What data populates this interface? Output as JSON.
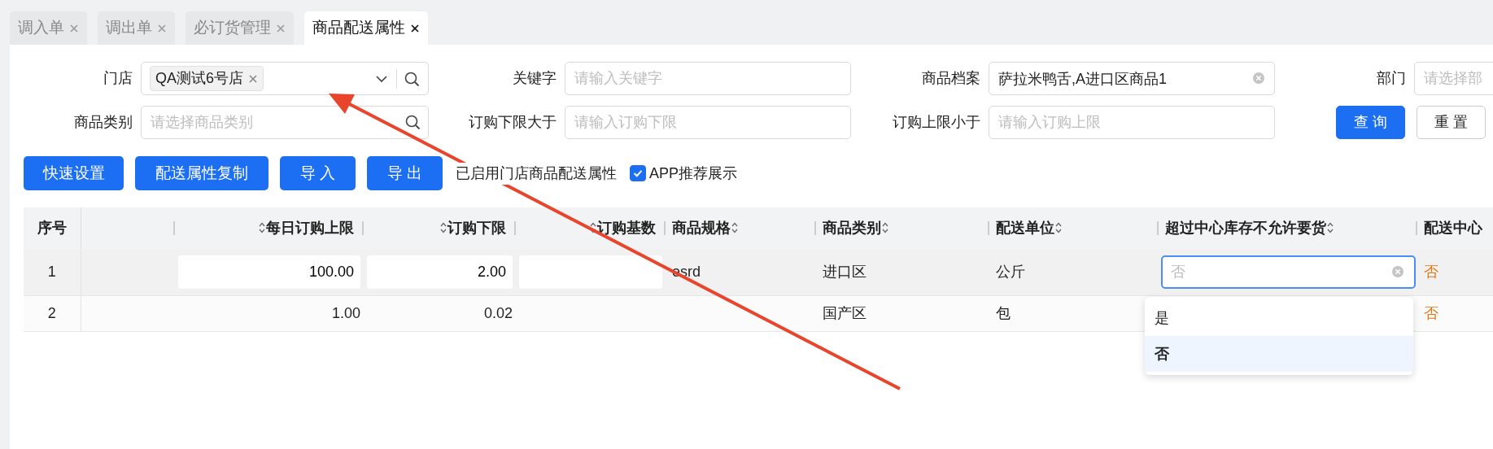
{
  "tabs": [
    {
      "label": "调入单",
      "selected": false
    },
    {
      "label": "调出单",
      "selected": false
    },
    {
      "label": "必订货管理",
      "selected": false
    },
    {
      "label": "商品配送属性",
      "selected": true
    }
  ],
  "filters": [
    {
      "label": "门店",
      "kind": "tags",
      "tags": [
        "QA测试6号店"
      ]
    },
    {
      "label": "关键字",
      "kind": "input",
      "placeholder": "请输入关键字"
    },
    {
      "label": "商品档案",
      "kind": "clearable",
      "value": "萨拉米鸭舌,A进口区商品1"
    },
    {
      "label": "部门",
      "kind": "input",
      "placeholder": "请选择部"
    },
    {
      "label": "商品类别",
      "kind": "search",
      "placeholder": "请选择商品类别"
    },
    {
      "label": "订购下限大于",
      "kind": "input",
      "placeholder": "请输入订购下限"
    },
    {
      "label": "订购上限小于",
      "kind": "input",
      "placeholder": "请输入订购上限"
    }
  ],
  "form_buttons": [
    {
      "label": "查 询",
      "kind": "primary"
    },
    {
      "label": "重 置",
      "kind": "default"
    }
  ],
  "actions": [
    "快速设置",
    "配送属性复制",
    "导 入",
    "导 出"
  ],
  "status_text": "已启用门店商品配送属性",
  "app_checkbox": {
    "label": "APP推荐展示",
    "checked": true
  },
  "table": {
    "columns": [
      {
        "label": "序号",
        "kind": "index"
      },
      {
        "kind": "blank"
      },
      {
        "label": "每日订购上限",
        "kind": "numeric"
      },
      {
        "label": "订购下限",
        "kind": "numeric"
      },
      {
        "label": "订购基数",
        "kind": "numeric"
      },
      {
        "label": "商品规格",
        "kind": "text"
      },
      {
        "label": "商品类别",
        "kind": "text"
      },
      {
        "label": "配送单位",
        "kind": "text"
      },
      {
        "label": "超过中心库存不允许要货",
        "kind": "text"
      },
      {
        "label": "配送中心",
        "kind": "cut"
      }
    ],
    "rows": [
      {
        "highlighted": true,
        "cells": [
          {
            "kind": "text",
            "text": "1"
          },
          {
            "kind": "empty"
          },
          {
            "kind": "input",
            "text": "100.00"
          },
          {
            "kind": "input",
            "text": "2.00"
          },
          {
            "kind": "input"
          },
          {
            "kind": "text",
            "text": "esrd"
          },
          {
            "kind": "text",
            "text": "进口区"
          },
          {
            "kind": "text",
            "text": "公斤"
          },
          {
            "kind": "select",
            "placeholder": "否",
            "options": [
              {
                "label": "是",
                "selected": false
              },
              {
                "label": "否",
                "selected": true
              }
            ]
          },
          {
            "kind": "flag",
            "text": "否"
          }
        ]
      },
      {
        "highlighted": false,
        "cells": [
          {
            "kind": "text",
            "text": "2"
          },
          {
            "kind": "empty"
          },
          {
            "kind": "text",
            "text": "1.00"
          },
          {
            "kind": "text",
            "text": "0.02"
          },
          {
            "kind": "empty"
          },
          {
            "kind": "empty"
          },
          {
            "kind": "text",
            "text": "国产区"
          },
          {
            "kind": "text",
            "text": "包"
          },
          {
            "kind": "empty"
          },
          {
            "kind": "flag",
            "text": "否"
          }
        ]
      }
    ]
  }
}
